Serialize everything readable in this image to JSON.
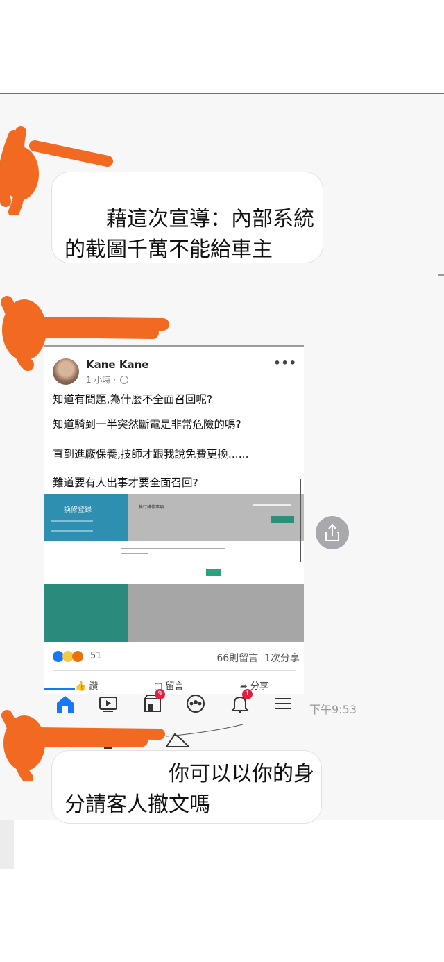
{
  "chat": {
    "message_1": "　　藉這次宣導：內部系統的截圖千萬不能給車主",
    "message_2": "　　　　　你可以以你的身分請客人撤文嗎",
    "timestamp": "下午9:53"
  },
  "post": {
    "author": "Kane Kane",
    "time": "1 小時 · ",
    "more": "•••",
    "lines": [
      "知道有問題,為什麼不全面召回呢?",
      "知道騎到一半突然斷電是非常危險的嗎?",
      "直到進廠保養,技師才跟我說免費更換......",
      "難道要有人出事才要全面召回?"
    ],
    "screenshot": {
      "title": "换修登録",
      "label": "執行維修事項"
    },
    "reaction_count": "51",
    "comments": "66則留言",
    "shares": "1次分享",
    "actions": {
      "like": "讚",
      "comment": "留言",
      "share": "分享"
    }
  },
  "navbar": {
    "marketplace_badge": "9",
    "notifications_badge": "1"
  },
  "colors": {
    "scribble": "#f26a21",
    "facebook_blue": "#1877f2",
    "badge_red": "#e41e3f"
  },
  "icons": [
    "home-icon",
    "video-icon",
    "marketplace-icon",
    "groups-icon",
    "bell-icon",
    "menu-icon",
    "share-icon",
    "globe-icon",
    "like-icon",
    "comment-icon",
    "share-arrow-icon"
  ]
}
